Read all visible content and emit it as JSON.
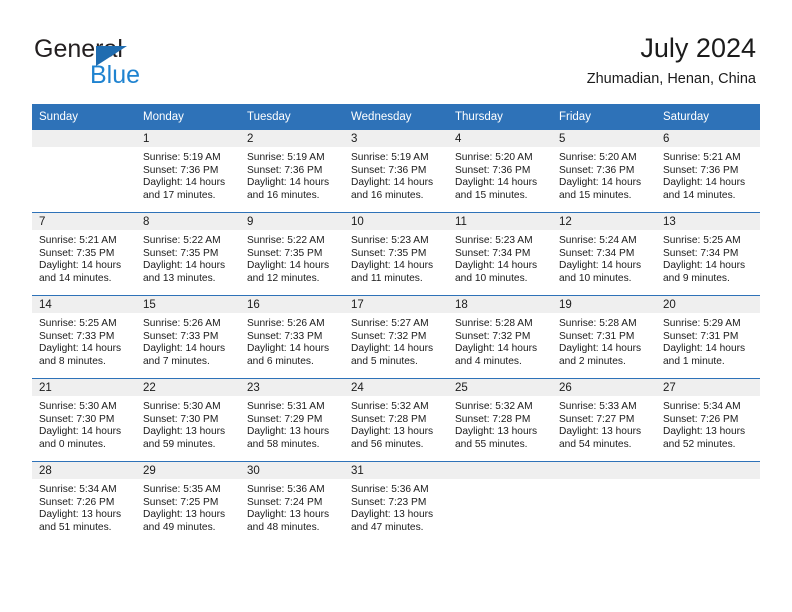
{
  "brand": {
    "name_top": "General",
    "name_bottom": "Blue",
    "triangle_color": "#1f6cb0",
    "blue_color": "#1f83d0"
  },
  "header": {
    "title": "July 2024",
    "subtitle": "Zhumadian, Henan, China",
    "header_bg": "#2e72b8",
    "band_bg": "#efefef"
  },
  "weekdays": [
    "Sunday",
    "Monday",
    "Tuesday",
    "Wednesday",
    "Thursday",
    "Friday",
    "Saturday"
  ],
  "weeks": [
    [
      {
        "day": "",
        "l1": "",
        "l2": "",
        "l3": "",
        "l4": ""
      },
      {
        "day": "1",
        "l1": "Sunrise: 5:19 AM",
        "l2": "Sunset: 7:36 PM",
        "l3": "Daylight: 14 hours",
        "l4": "and 17 minutes."
      },
      {
        "day": "2",
        "l1": "Sunrise: 5:19 AM",
        "l2": "Sunset: 7:36 PM",
        "l3": "Daylight: 14 hours",
        "l4": "and 16 minutes."
      },
      {
        "day": "3",
        "l1": "Sunrise: 5:19 AM",
        "l2": "Sunset: 7:36 PM",
        "l3": "Daylight: 14 hours",
        "l4": "and 16 minutes."
      },
      {
        "day": "4",
        "l1": "Sunrise: 5:20 AM",
        "l2": "Sunset: 7:36 PM",
        "l3": "Daylight: 14 hours",
        "l4": "and 15 minutes."
      },
      {
        "day": "5",
        "l1": "Sunrise: 5:20 AM",
        "l2": "Sunset: 7:36 PM",
        "l3": "Daylight: 14 hours",
        "l4": "and 15 minutes."
      },
      {
        "day": "6",
        "l1": "Sunrise: 5:21 AM",
        "l2": "Sunset: 7:36 PM",
        "l3": "Daylight: 14 hours",
        "l4": "and 14 minutes."
      }
    ],
    [
      {
        "day": "7",
        "l1": "Sunrise: 5:21 AM",
        "l2": "Sunset: 7:35 PM",
        "l3": "Daylight: 14 hours",
        "l4": "and 14 minutes."
      },
      {
        "day": "8",
        "l1": "Sunrise: 5:22 AM",
        "l2": "Sunset: 7:35 PM",
        "l3": "Daylight: 14 hours",
        "l4": "and 13 minutes."
      },
      {
        "day": "9",
        "l1": "Sunrise: 5:22 AM",
        "l2": "Sunset: 7:35 PM",
        "l3": "Daylight: 14 hours",
        "l4": "and 12 minutes."
      },
      {
        "day": "10",
        "l1": "Sunrise: 5:23 AM",
        "l2": "Sunset: 7:35 PM",
        "l3": "Daylight: 14 hours",
        "l4": "and 11 minutes."
      },
      {
        "day": "11",
        "l1": "Sunrise: 5:23 AM",
        "l2": "Sunset: 7:34 PM",
        "l3": "Daylight: 14 hours",
        "l4": "and 10 minutes."
      },
      {
        "day": "12",
        "l1": "Sunrise: 5:24 AM",
        "l2": "Sunset: 7:34 PM",
        "l3": "Daylight: 14 hours",
        "l4": "and 10 minutes."
      },
      {
        "day": "13",
        "l1": "Sunrise: 5:25 AM",
        "l2": "Sunset: 7:34 PM",
        "l3": "Daylight: 14 hours",
        "l4": "and 9 minutes."
      }
    ],
    [
      {
        "day": "14",
        "l1": "Sunrise: 5:25 AM",
        "l2": "Sunset: 7:33 PM",
        "l3": "Daylight: 14 hours",
        "l4": "and 8 minutes."
      },
      {
        "day": "15",
        "l1": "Sunrise: 5:26 AM",
        "l2": "Sunset: 7:33 PM",
        "l3": "Daylight: 14 hours",
        "l4": "and 7 minutes."
      },
      {
        "day": "16",
        "l1": "Sunrise: 5:26 AM",
        "l2": "Sunset: 7:33 PM",
        "l3": "Daylight: 14 hours",
        "l4": "and 6 minutes."
      },
      {
        "day": "17",
        "l1": "Sunrise: 5:27 AM",
        "l2": "Sunset: 7:32 PM",
        "l3": "Daylight: 14 hours",
        "l4": "and 5 minutes."
      },
      {
        "day": "18",
        "l1": "Sunrise: 5:28 AM",
        "l2": "Sunset: 7:32 PM",
        "l3": "Daylight: 14 hours",
        "l4": "and 4 minutes."
      },
      {
        "day": "19",
        "l1": "Sunrise: 5:28 AM",
        "l2": "Sunset: 7:31 PM",
        "l3": "Daylight: 14 hours",
        "l4": "and 2 minutes."
      },
      {
        "day": "20",
        "l1": "Sunrise: 5:29 AM",
        "l2": "Sunset: 7:31 PM",
        "l3": "Daylight: 14 hours",
        "l4": "and 1 minute."
      }
    ],
    [
      {
        "day": "21",
        "l1": "Sunrise: 5:30 AM",
        "l2": "Sunset: 7:30 PM",
        "l3": "Daylight: 14 hours",
        "l4": "and 0 minutes."
      },
      {
        "day": "22",
        "l1": "Sunrise: 5:30 AM",
        "l2": "Sunset: 7:30 PM",
        "l3": "Daylight: 13 hours",
        "l4": "and 59 minutes."
      },
      {
        "day": "23",
        "l1": "Sunrise: 5:31 AM",
        "l2": "Sunset: 7:29 PM",
        "l3": "Daylight: 13 hours",
        "l4": "and 58 minutes."
      },
      {
        "day": "24",
        "l1": "Sunrise: 5:32 AM",
        "l2": "Sunset: 7:28 PM",
        "l3": "Daylight: 13 hours",
        "l4": "and 56 minutes."
      },
      {
        "day": "25",
        "l1": "Sunrise: 5:32 AM",
        "l2": "Sunset: 7:28 PM",
        "l3": "Daylight: 13 hours",
        "l4": "and 55 minutes."
      },
      {
        "day": "26",
        "l1": "Sunrise: 5:33 AM",
        "l2": "Sunset: 7:27 PM",
        "l3": "Daylight: 13 hours",
        "l4": "and 54 minutes."
      },
      {
        "day": "27",
        "l1": "Sunrise: 5:34 AM",
        "l2": "Sunset: 7:26 PM",
        "l3": "Daylight: 13 hours",
        "l4": "and 52 minutes."
      }
    ],
    [
      {
        "day": "28",
        "l1": "Sunrise: 5:34 AM",
        "l2": "Sunset: 7:26 PM",
        "l3": "Daylight: 13 hours",
        "l4": "and 51 minutes."
      },
      {
        "day": "29",
        "l1": "Sunrise: 5:35 AM",
        "l2": "Sunset: 7:25 PM",
        "l3": "Daylight: 13 hours",
        "l4": "and 49 minutes."
      },
      {
        "day": "30",
        "l1": "Sunrise: 5:36 AM",
        "l2": "Sunset: 7:24 PM",
        "l3": "Daylight: 13 hours",
        "l4": "and 48 minutes."
      },
      {
        "day": "31",
        "l1": "Sunrise: 5:36 AM",
        "l2": "Sunset: 7:23 PM",
        "l3": "Daylight: 13 hours",
        "l4": "and 47 minutes."
      },
      {
        "day": "",
        "l1": "",
        "l2": "",
        "l3": "",
        "l4": ""
      },
      {
        "day": "",
        "l1": "",
        "l2": "",
        "l3": "",
        "l4": ""
      },
      {
        "day": "",
        "l1": "",
        "l2": "",
        "l3": "",
        "l4": ""
      }
    ]
  ]
}
